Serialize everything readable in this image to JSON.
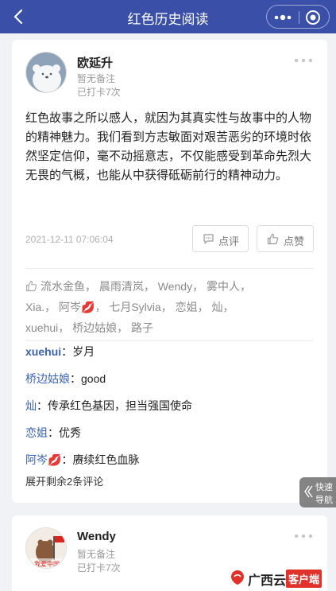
{
  "header": {
    "title": "红色历史阅读"
  },
  "post": {
    "author": "欧延升",
    "note": "暂无备注",
    "checkin": "已打卡7次",
    "content": "红色故事之所以感人，就因为其真实性与故事中的人物的精神魅力。我们看到方志敏面对艰苦恶劣的环境时依然坚定信仰，毫不动摇意志，不仅能感受到革命先烈大无畏的气概，也能从中获得砥砺前行的精神动力。",
    "time": "2021-12-11 07:06:04",
    "comment_label": "点评",
    "like_label": "点赞",
    "likers_line1": "流水金鱼， 晨雨清岚， Wendy， 雾中人，",
    "likers_line2": "Xia.， 阿岑💋， 七月Sylvia， 恋姐， 灿，",
    "likers_line3": "xuehui， 桥边姑娘， 路子",
    "comments": [
      {
        "name": "xuehui",
        "sep": "：",
        "text": "岁月"
      },
      {
        "name": "桥边姑娘",
        "sep": "：",
        "text": "good"
      },
      {
        "name": "灿",
        "sep": "：",
        "text": "传承红色基因，担当强国使命"
      },
      {
        "name": "恋姐",
        "sep": "：",
        "text": "优秀"
      },
      {
        "name": "阿岑💋",
        "sep": "：",
        "text": "赓续红色血脉"
      }
    ],
    "expand": "展开剩余2条评论"
  },
  "post2": {
    "author": "Wendy",
    "note": "暂无备注",
    "checkin": "已打卡7次",
    "avatar_text": "我爱中国"
  },
  "quick_nav": {
    "line1": "快速",
    "line2": "导航"
  },
  "brand": {
    "name": "广西云",
    "tag": "客户端"
  },
  "colors": {
    "header": "#3a4fa8",
    "link": "#3a63b8",
    "brand_red": "#e0322b"
  }
}
